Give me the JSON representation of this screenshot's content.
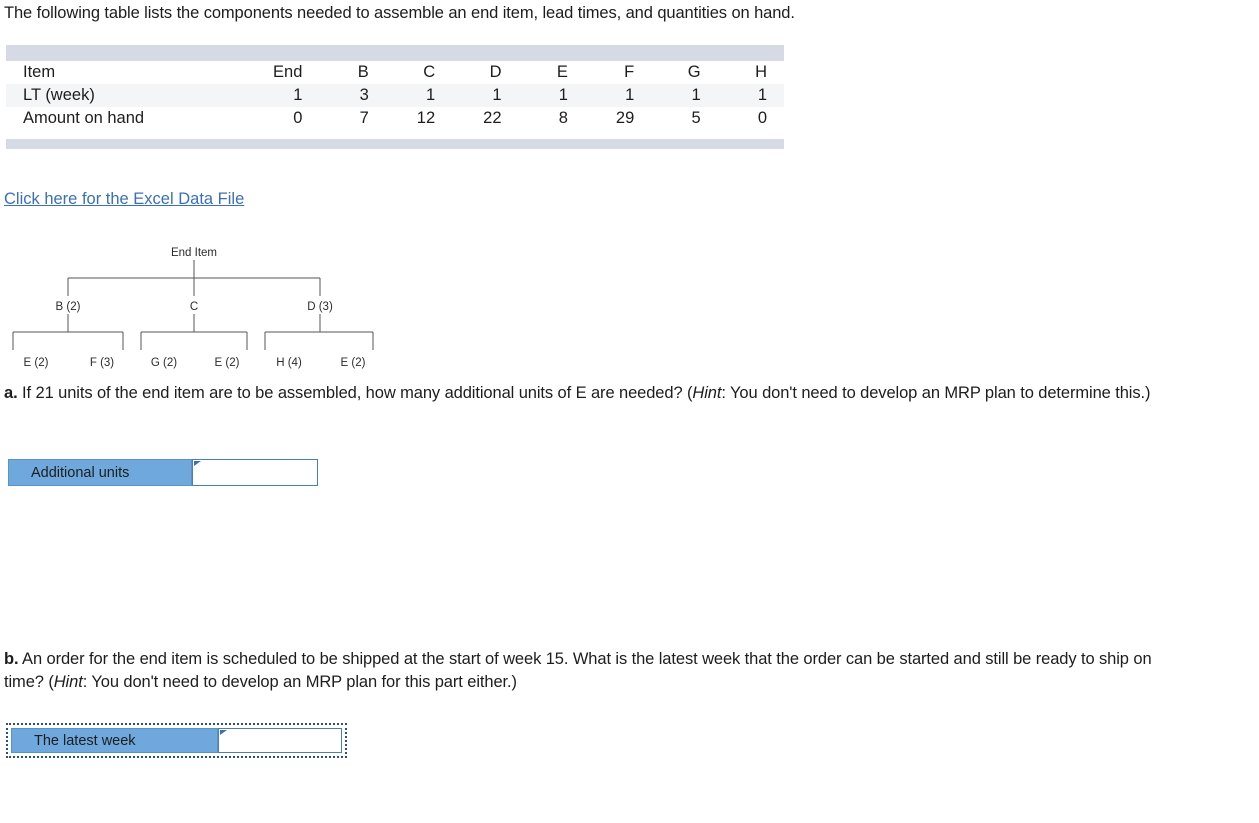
{
  "intro": {
    "text": "The following table lists the components needed to assemble an end item, lead times, and quantities on hand."
  },
  "table": {
    "row_labels": [
      "Item",
      "LT (week)",
      "Amount on hand"
    ],
    "rows": [
      {
        "label": "Item",
        "values": [
          "End",
          "B",
          "C",
          "D",
          "E",
          "F",
          "G",
          "H"
        ]
      },
      {
        "label": "LT (week)",
        "values": [
          "1",
          "3",
          "1",
          "1",
          "1",
          "1",
          "1",
          "1"
        ]
      },
      {
        "label": "Amount on hand",
        "values": [
          "0",
          "7",
          "12",
          "22",
          "8",
          "29",
          "5",
          "0"
        ]
      }
    ],
    "band_color": "#d5dae5",
    "shade_color": "#f4f5f7"
  },
  "excel_link": {
    "label": "Click here for the Excel Data File",
    "color": "#3b6fbb"
  },
  "bom_tree": {
    "root": "End Item",
    "level1": [
      "B (2)",
      "C",
      "D (3)"
    ],
    "level2": [
      "E (2)",
      "F (3)",
      "G (2)",
      "E (2)",
      "H (4)",
      "E (2)"
    ],
    "line_color": "#555555"
  },
  "questions": {
    "a": {
      "marker": "a.",
      "text_1": " If 21 units of the end item are to be assembled, how many additional units of E are needed? (",
      "hint_word": "Hint",
      "text_2": ": You don't need to develop an MRP plan to determine this.)"
    },
    "b": {
      "marker": "b.",
      "text_1": " An order for the end item is scheduled to be shipped at the start of week 15. What is the latest week that the order can be started and still be ready to ship on time? (",
      "hint_word": "Hint",
      "text_2": ": You don't need to develop an MRP plan for this part either.)"
    }
  },
  "answers": {
    "a": {
      "label": "Additional units",
      "value": "",
      "placeholder": ""
    },
    "b": {
      "label": "The latest week",
      "value": "",
      "placeholder": ""
    },
    "accent_blue": "#6fa8dc",
    "border_blue": "#4a7fb5",
    "selection_border": "#2d4f87"
  }
}
